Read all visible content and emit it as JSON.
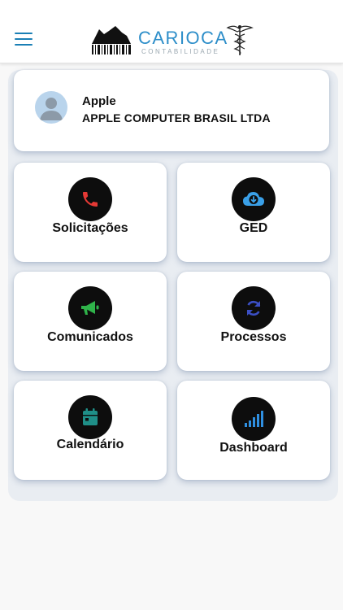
{
  "header": {
    "logo_title": "CARIOCA",
    "logo_subtitle": "CONTABILIDADE",
    "brand_color": "#2d8ec9"
  },
  "profile": {
    "name": "Apple",
    "company": "APPLE COMPUTER BRASIL LTDA"
  },
  "tiles": [
    {
      "label": "Solicitações",
      "icon": "phone-icon",
      "icon_color": "#e53935"
    },
    {
      "label": "GED",
      "icon": "cloud-download-icon",
      "icon_color": "#3aa0e8"
    },
    {
      "label": "Comunicados",
      "icon": "megaphone-icon",
      "icon_color": "#2fb34a"
    },
    {
      "label": "Processos",
      "icon": "sync-icon",
      "icon_color": "#3b4fc4"
    },
    {
      "label": "Calendário",
      "icon": "calendar-icon",
      "icon_color": "#1f8f88"
    },
    {
      "label": "Dashboard",
      "icon": "signal-bars-icon",
      "icon_color": "#2f8fe0"
    }
  ]
}
